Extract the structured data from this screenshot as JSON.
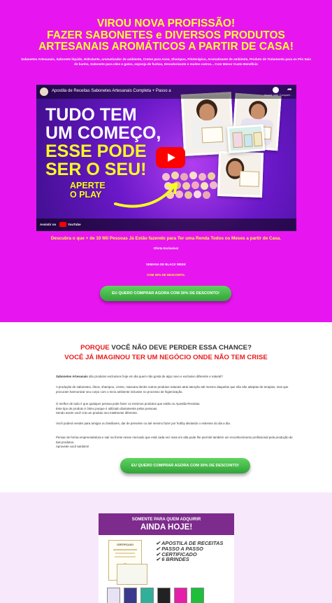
{
  "hero": {
    "headline": [
      "VIROU NOVA PROFISSÃO!",
      "FAZER SABONETES e DIVERSOS PRODUTOS",
      "ARTESANAIS AROMÁTICOS A PARTIR DE CASA!"
    ],
    "subline": "Sabonetes Artesanais, Sabonete líquido, Hidratante, aromatizador de ambiente, Creme para Acne, Shampoo, Fitoterápico, Aromatizante de ambiente, Produto de Tratamento para os Pés Sais de banho, Sabonete para cães e gatos, esponja de fuchas, Desodorizante e muitos outros... Com Menor Custo Benefício",
    "caption": "Descubra o que + de 10 Mil Pessoas Já Estão fazendo para Ter uma Renda Todos os Meses a partir de Casa.",
    "offer_exclusive": "Oferta Exclusiva!",
    "black_week": "SEMANA DE BLACK WEEK",
    "discount": "COM 30% DE DESCONTO.",
    "cta": "EU QUERO COMPRAR AGORA COM 30% DE DESCONTO!"
  },
  "video": {
    "title": "Apostila de Receitas Sabonetes Artesanais Completa + Passo a",
    "watch_later": "Assistir mais...",
    "share": "Comparti...",
    "big_lines": [
      "TUDO TEM",
      "UM COMEÇO,",
      "ESSE PODE",
      "SER O SEU!"
    ],
    "aperte": [
      "APERTE",
      "O PLAY"
    ],
    "watch_on": "Assistir no",
    "youtube": "YouTube"
  },
  "section2": {
    "why_red": "PORQUE",
    "why_rest": " VOCÊ NÃO DEVE PERDER ESSA CHANCE?",
    "already_dark": "VOCÊ JÁ IMAGINOU TER UM NEGÓCIO ",
    "already_red": "ONDE NÃO TEM CRISE",
    "p1_bold": "Sabonetes Artesanais",
    "p1_rest": " são produtos exclusivos hoje em dia quem não gosta de algo novo e exclusivo diferente e natural?",
    "p2": "A produção de sabonetes, óleos, shampoo, creme, mascara dentre outros produtos naturais atrai atenção até mesmo daquelas que não são adeptas de terapias, mas que procuram harmonizar seu corpo com o meio ambiente inclusive no processo de higienização.",
    "p3": [
      "O melhor de tudo é que qualquer pessoa pode fazer os mesmos produtos que estão no Apostila Receitas.",
      "Este tipo de produto é ótimo porque é utilizado diariamente pelas pessoas.",
      "Sendo assim você cria um produto seu totalmente diferente."
    ],
    "p4": "Você poderá vender para amigos ou familiares, dar de presente ou até mesmo fazer por hobby aliviando o estresse do dia a dia.",
    "p5": [
      "Pensar de forma empreendedora e sair na frente nesse mercado que está cada vez mais em alta pode lhe permitir também um reconhecimento profissional pela produção de tais produtos.",
      "Aproveite você também!"
    ],
    "cta": "EU QUERO COMPRAR AGORA COM 30% DE DESCONTO!"
  },
  "bonus": {
    "small": "SOMENTE PARA QUEM ADQUIRIR",
    "big": "AINDA HOJE!",
    "items": [
      "✔ APOSTILA DE RECEITAS",
      "✔ PASSO A PASSO",
      "✔ CERTIFICADO",
      "✔ 6 BRINDES"
    ],
    "cert_title": "CERTIFICADO"
  },
  "colors": {
    "hero_bg": "#e716f0",
    "headline": "#f8ff2e",
    "accent_red": "#e61b1b",
    "cta_green": "#3fb544",
    "bonus_bg": "#f7e9fb",
    "banner_purple": "#7d2b8c"
  }
}
